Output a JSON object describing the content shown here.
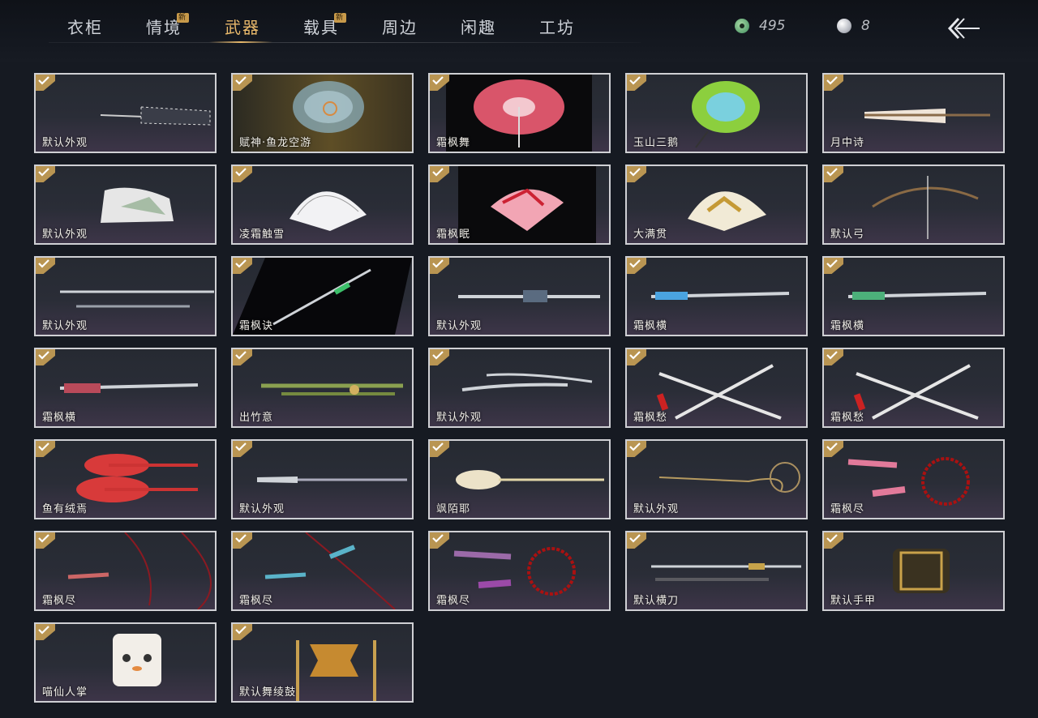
{
  "tabs": [
    {
      "label": "衣柜",
      "new": ""
    },
    {
      "label": "情境",
      "new": "新"
    },
    {
      "label": "武器",
      "new": ""
    },
    {
      "label": "载具",
      "new": "新"
    },
    {
      "label": "周边",
      "new": ""
    },
    {
      "label": "闲趣",
      "new": ""
    },
    {
      "label": "工坊",
      "new": ""
    }
  ],
  "active_tab": "武器",
  "currency": {
    "jade": "495",
    "pearl": "8"
  },
  "icons": {
    "jade": "jade-coin-icon",
    "pearl": "pearl-icon",
    "back": "back-arrow-icon",
    "owned": "owned-check-icon"
  },
  "colors": {
    "accent": "#e9b96b",
    "check": "#b99552",
    "card_border": "#cfd0d4"
  },
  "items": [
    {
      "name": "默认外观",
      "kind": "umbrella-dark"
    },
    {
      "name": "赋神·鱼龙空游",
      "kind": "umbrella-crystal"
    },
    {
      "name": "霜枫舞",
      "kind": "umbrella-red"
    },
    {
      "name": "玉山三鹅",
      "kind": "umbrella-green"
    },
    {
      "name": "月中诗",
      "kind": "umbrella-white"
    },
    {
      "name": "默认外观",
      "kind": "fan-light"
    },
    {
      "name": "凌霜触雪",
      "kind": "fan-white"
    },
    {
      "name": "霜枫眠",
      "kind": "fan-red"
    },
    {
      "name": "大满贯",
      "kind": "fan-gold"
    },
    {
      "name": "默认弓",
      "kind": "bow"
    },
    {
      "name": "默认外观",
      "kind": "sword-pair"
    },
    {
      "name": "霜枫诀",
      "kind": "sword-diag"
    },
    {
      "name": "默认外观",
      "kind": "blade"
    },
    {
      "name": "霜枫横",
      "kind": "blade-blue"
    },
    {
      "name": "霜枫横",
      "kind": "blade-green"
    },
    {
      "name": "霜枫横",
      "kind": "blade-red"
    },
    {
      "name": "出竹意",
      "kind": "bamboo"
    },
    {
      "name": "默认外观",
      "kind": "twin-sabre"
    },
    {
      "name": "霜枫愁",
      "kind": "cross-sabre"
    },
    {
      "name": "霜枫愁",
      "kind": "cross-sabre"
    },
    {
      "name": "鱼有绒焉",
      "kind": "fish"
    },
    {
      "name": "默认外观",
      "kind": "spear"
    },
    {
      "name": "飒陌耶",
      "kind": "scepter"
    },
    {
      "name": "默认外观",
      "kind": "chain"
    },
    {
      "name": "霜枫尽",
      "kind": "rope-dart-pink"
    },
    {
      "name": "霜枫尽",
      "kind": "rope-dart-red"
    },
    {
      "name": "霜枫尽",
      "kind": "rope-dart-blue"
    },
    {
      "name": "霜枫尽",
      "kind": "rope-dart-purple"
    },
    {
      "name": "默认横刀",
      "kind": "hengdao"
    },
    {
      "name": "默认手甲",
      "kind": "gauntlet"
    },
    {
      "name": "喵仙人掌",
      "kind": "cat-paw"
    },
    {
      "name": "默认舞绫鼓",
      "kind": "drum"
    }
  ]
}
